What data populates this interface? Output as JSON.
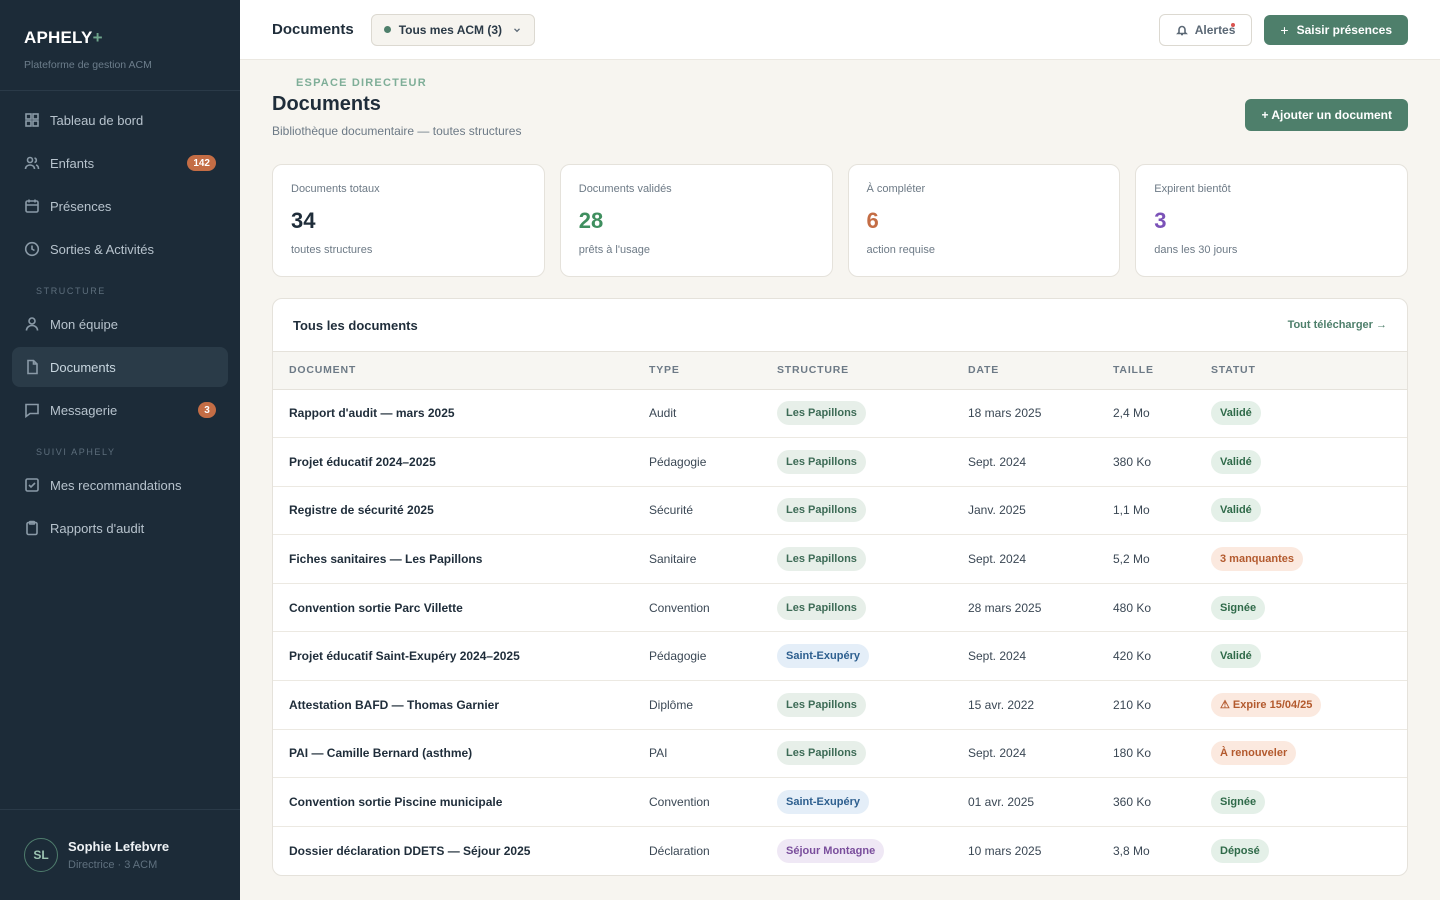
{
  "brand": {
    "name": "APHELY",
    "plus": "+",
    "tagline": "Plateforme de gestion ACM"
  },
  "sidebar": {
    "section_main": "ESPACE DIRECTEUR",
    "section_structure": "STRUCTURE",
    "section_suivi": "SUIVI APHELY",
    "items": [
      {
        "label": "Tableau de bord",
        "icon": "grid-icon"
      },
      {
        "label": "Enfants",
        "icon": "users-icon",
        "count": "142"
      },
      {
        "label": "Présences",
        "icon": "calendar-icon"
      },
      {
        "label": "Sorties & Activités",
        "icon": "clock-icon"
      },
      {
        "label": "Mon équipe",
        "icon": "user-icon"
      },
      {
        "label": "Documents",
        "icon": "file-icon",
        "active": true
      },
      {
        "label": "Messagerie",
        "icon": "message-icon",
        "count": "3"
      },
      {
        "label": "Mes recommandations",
        "icon": "check-square-icon"
      },
      {
        "label": "Rapports d'audit",
        "icon": "clipboard-icon"
      }
    ]
  },
  "user": {
    "initials": "SL",
    "name": "Sophie Lefebvre",
    "role": "Directrice · 3 ACM"
  },
  "topbar": {
    "title": "Documents",
    "scope": "Tous mes ACM (3)",
    "alerts": "Alertes",
    "primary": "Saisir présences"
  },
  "page": {
    "title": "Documents",
    "subtitle": "Bibliothèque documentaire — toutes structures",
    "add_button": "+ Ajouter un document"
  },
  "stats": [
    {
      "label": "Documents totaux",
      "value": "34",
      "note": "toutes structures",
      "color": "#1f2d3a"
    },
    {
      "label": "Documents validés",
      "value": "28",
      "note": "prêts à l'usage",
      "color": "#3f8f5f"
    },
    {
      "label": "À compléter",
      "value": "6",
      "note": "action requise",
      "color": "#c46d45"
    },
    {
      "label": "Expirent bientôt",
      "value": "3",
      "note": "dans les 30 jours",
      "color": "#7b52b8"
    }
  ],
  "table": {
    "title": "Tous les documents",
    "download_all": "Tout télécharger →",
    "headers": [
      "DOCUMENT",
      "TYPE",
      "STRUCTURE",
      "DATE",
      "TAILLE",
      "STATUT"
    ],
    "rows": [
      {
        "document": "Rapport d'audit — mars 2025",
        "type": "Audit",
        "structure": "Les Papillons",
        "date": "18 mars 2025",
        "size": "2,4 Mo",
        "status": "Validé"
      },
      {
        "document": "Projet éducatif 2024–2025",
        "type": "Pédagogie",
        "structure": "Les Papillons",
        "date": "Sept. 2024",
        "size": "380 Ko",
        "status": "Validé"
      },
      {
        "document": "Registre de sécurité 2025",
        "type": "Sécurité",
        "structure": "Les Papillons",
        "date": "Janv. 2025",
        "size": "1,1 Mo",
        "status": "Validé"
      },
      {
        "document": "Fiches sanitaires — Les Papillons",
        "type": "Sanitaire",
        "structure": "Les Papillons",
        "date": "Sept. 2024",
        "size": "5,2 Mo",
        "status": "3 manquantes"
      },
      {
        "document": "Convention sortie Parc Villette",
        "type": "Convention",
        "structure": "Les Papillons",
        "date": "28 mars 2025",
        "size": "480 Ko",
        "status": "Signée"
      },
      {
        "document": "Projet éducatif Saint-Exupéry 2024–2025",
        "type": "Pédagogie",
        "structure": "Saint-Exupéry",
        "date": "Sept. 2024",
        "size": "420 Ko",
        "status": "Validé"
      },
      {
        "document": "Attestation BAFD — Thomas Garnier",
        "type": "Diplôme",
        "structure": "Les Papillons",
        "date": "15 avr. 2022",
        "size": "210 Ko",
        "status": "⚠ Expire 15/04/25"
      },
      {
        "document": "PAI — Camille Bernard (asthme)",
        "type": "PAI",
        "structure": "Les Papillons",
        "date": "Sept. 2024",
        "size": "180 Ko",
        "status": "À renouveler"
      },
      {
        "document": "Convention sortie Piscine municipale",
        "type": "Convention",
        "structure": "Saint-Exupéry",
        "date": "01 avr. 2025",
        "size": "360 Ko",
        "status": "Signée"
      },
      {
        "document": "Dossier déclaration DDETS — Séjour 2025",
        "type": "Déclaration",
        "structure": "Séjour Montagne",
        "date": "10 mars 2025",
        "size": "3,8 Mo",
        "status": "Déposé"
      }
    ]
  }
}
